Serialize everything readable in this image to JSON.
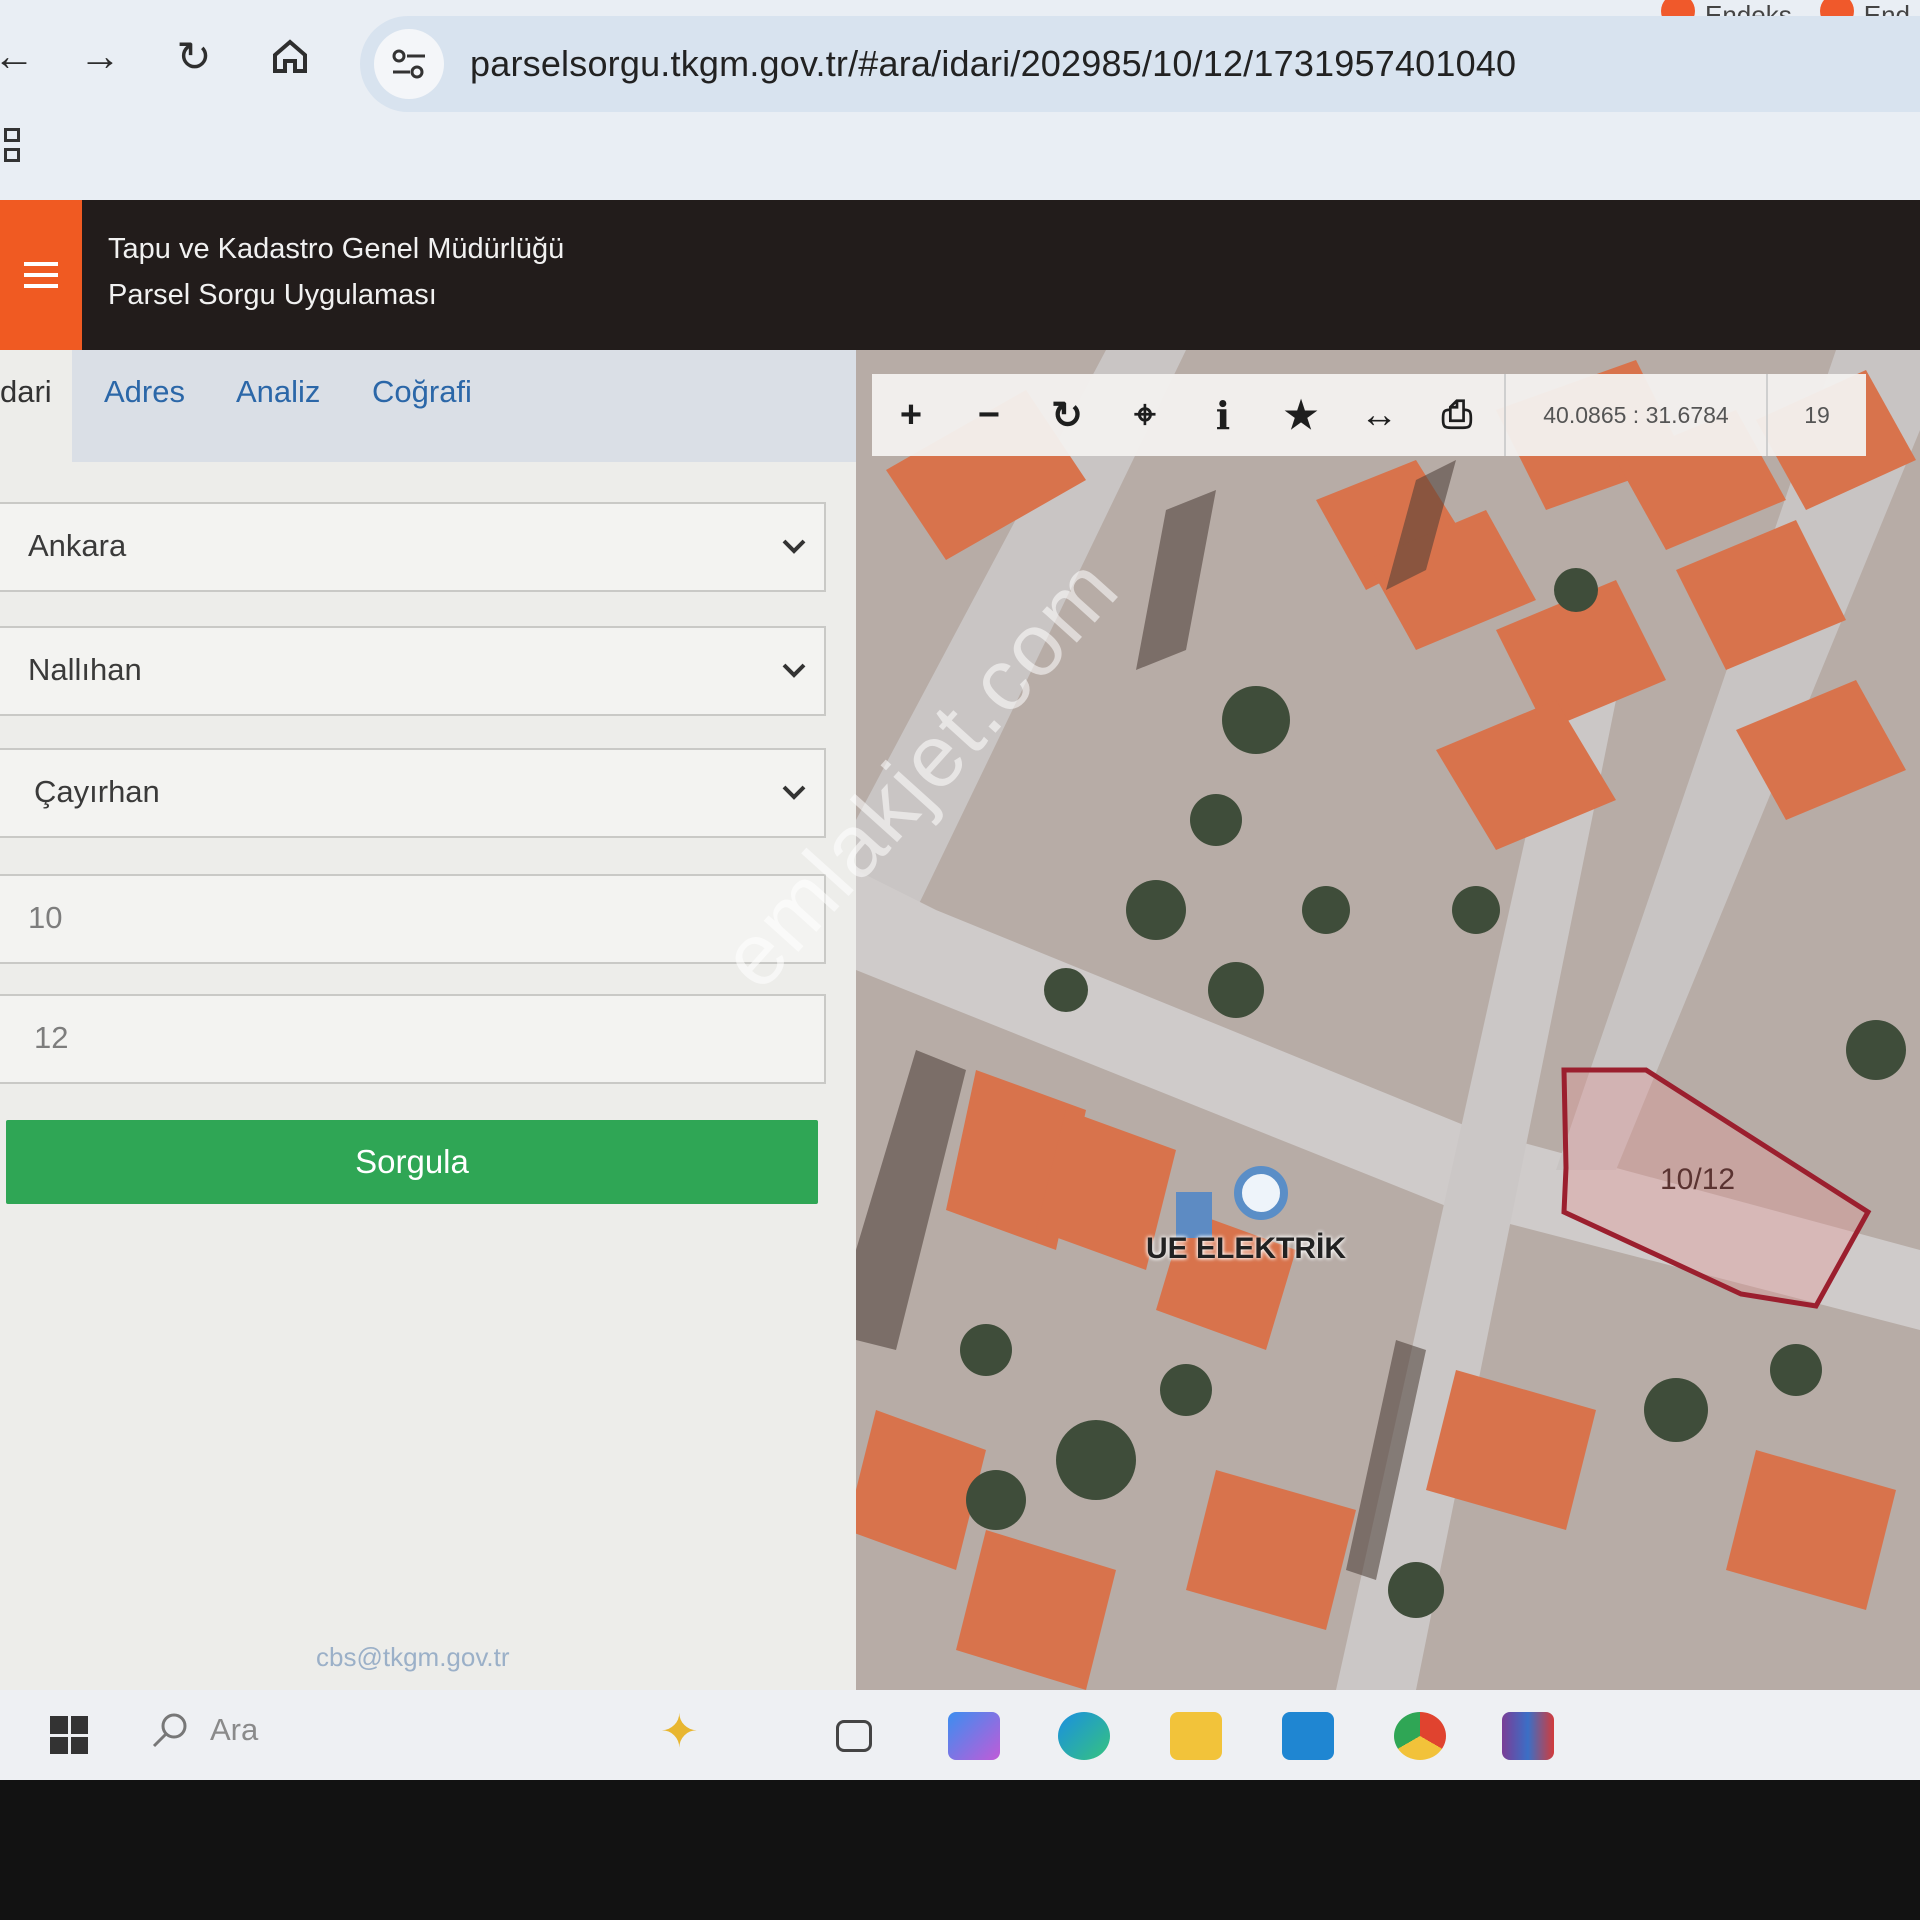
{
  "browser": {
    "url": "parselsorgu.tkgm.gov.tr/#ara/idari/202985/10/12/1731957401040",
    "top_tabs": [
      "Endeks",
      "End"
    ],
    "nav_icons": [
      "back-icon",
      "forward-icon",
      "reload-icon",
      "home-icon",
      "site-settings-icon"
    ]
  },
  "header": {
    "line1": "Tapu ve Kadastro Genel Müdürlüğü",
    "line2": "Parsel Sorgu Uygulaması",
    "accent_color": "#f05a22"
  },
  "tabs": [
    "dari",
    "Adres",
    "Analiz",
    "Coğrafi"
  ],
  "form": {
    "il": "Ankara",
    "ilce": "Nallıhan",
    "mahalle": "Çayırhan",
    "ada": "10",
    "parsel": "12",
    "submit_label": "Sorgula",
    "submit_color": "#2fa655"
  },
  "footer_email": "cbs@tkgm.gov.tr",
  "map": {
    "toolbar_icons": [
      "zoom-in-icon",
      "zoom-out-icon",
      "refresh-icon",
      "locate-icon",
      "info-icon",
      "star-icon",
      "measure-icon",
      "print-icon"
    ],
    "coordinates": "40.0865 : 31.6784",
    "zoom_level": "19",
    "parcel_label": "10/12",
    "poi_label": "UE ELEKTRİK",
    "watermark": "emlakjet.com"
  },
  "taskbar": {
    "search_label": "Ara",
    "apps": [
      "windows-icon",
      "copilot-icon",
      "task-view-icon",
      "copilot-app-icon",
      "edge-icon",
      "file-explorer-icon",
      "mail-icon",
      "chrome-icon",
      "winrar-icon"
    ]
  }
}
